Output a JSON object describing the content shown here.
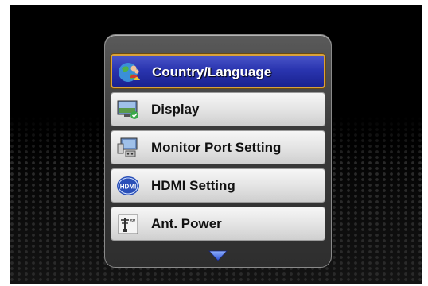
{
  "menu": {
    "items": [
      {
        "label": "Country/Language",
        "icon": "globe-people-icon",
        "selected": true
      },
      {
        "label": "Display",
        "icon": "display-icon",
        "selected": false
      },
      {
        "label": "Monitor Port Setting",
        "icon": "monitor-port-icon",
        "selected": false
      },
      {
        "label": "HDMI Setting",
        "icon": "hdmi-icon",
        "selected": false
      },
      {
        "label": "Ant. Power",
        "icon": "antenna-power-icon",
        "selected": false
      }
    ],
    "scroll_indicator": "scroll-down-arrow-icon"
  },
  "colors": {
    "selected_bg": "#2a35b0",
    "selected_border": "#d9a23a",
    "item_bg": "#e6e6e6",
    "text": "#111111",
    "arrow": "#4a6fe0"
  }
}
